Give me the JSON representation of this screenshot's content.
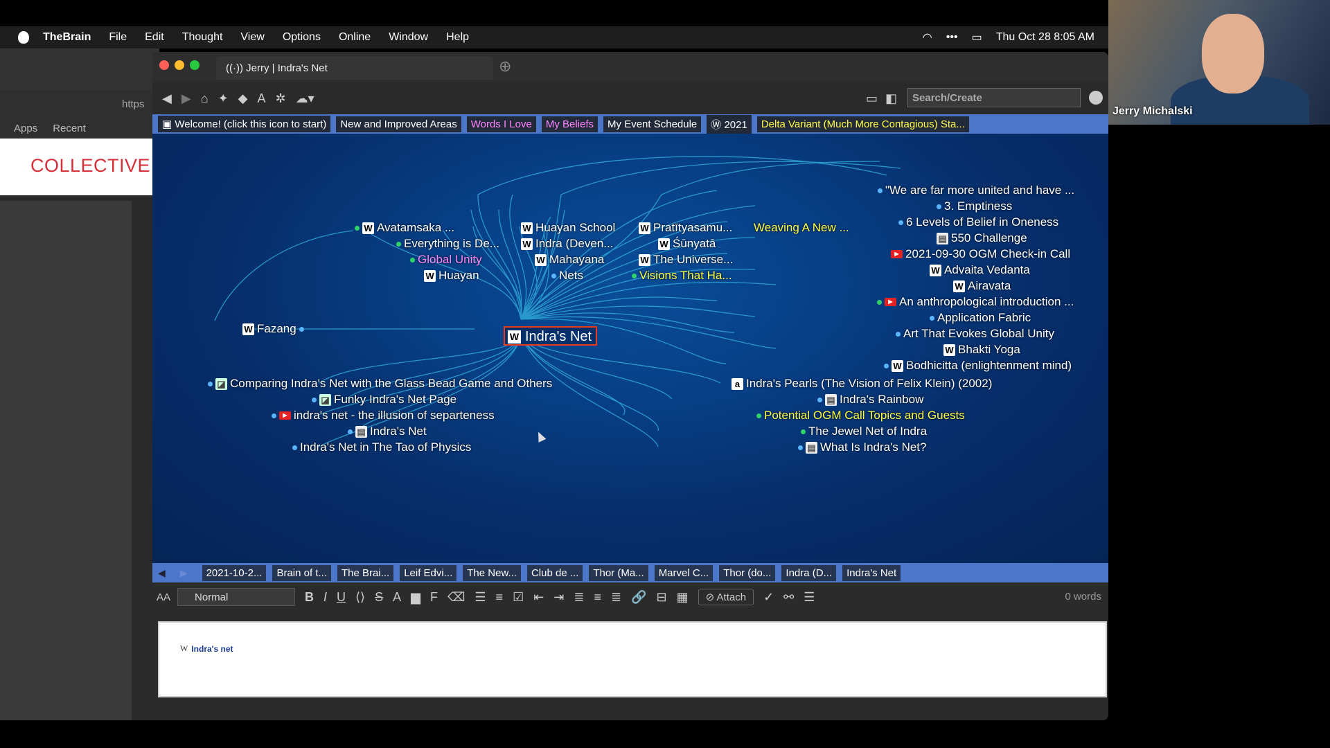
{
  "menubar": {
    "app": "TheBrain",
    "items": [
      "File",
      "Edit",
      "Thought",
      "View",
      "Options",
      "Online",
      "Window",
      "Help"
    ],
    "clock": "Thu Oct 28  8:05 AM"
  },
  "browser": {
    "address": "https",
    "bookmarks": [
      "Apps",
      "Recent"
    ],
    "site_title": "COLLECTIVE"
  },
  "window": {
    "tab_title": "Jerry | Indra's Net",
    "new_tab": "⊕",
    "search_placeholder": "Search/Create"
  },
  "pins": [
    {
      "label": "Welcome! (click this icon to start)",
      "style": "normal"
    },
    {
      "label": "New and Improved Areas",
      "style": "normal"
    },
    {
      "label": "Words I Love",
      "style": "pink"
    },
    {
      "label": "My Beliefs",
      "style": "pink"
    },
    {
      "label": "My Event Schedule",
      "style": "normal"
    },
    {
      "label": "2021",
      "style": "normal"
    },
    {
      "label": "Delta Variant (Much More Contagious) Sta...",
      "style": "yellow"
    }
  ],
  "plex": {
    "active": "Indra's Net",
    "parents": {
      "avatamsaka": "Avatamsaka ...",
      "huayan_school": "Huayan School",
      "pratityasamu": "Pratītyasamu...",
      "weaving": "Weaving A New ...",
      "everything": "Everything is De...",
      "indra_deven": "Indra (Deven...",
      "sunyata": "Śūnyatā",
      "global_unity": "Global Unity",
      "mahayana": "Mahayana",
      "universe": "The Universe...",
      "huayan": "Huayan",
      "nets": "Nets",
      "visions": "Visions That Ha..."
    },
    "jump": "Fazang",
    "siblings": [
      "\"We are far more united and have ...",
      "3. Emptiness",
      "6 Levels of Belief in Oneness",
      "550 Challenge",
      "2021-09-30 OGM Check-in Call",
      "Advaita Vedanta",
      "Airavata",
      "An anthropological introduction ...",
      "Application Fabric",
      "Art That Evokes Global Unity",
      "Bhakti Yoga",
      "Bodhicitta (enlightenment mind)"
    ],
    "children_left": [
      "Comparing Indra's Net with the Glass Bead Game and Others",
      "Funky Indra's Net Page",
      "indra's net - the illusion of separteness",
      "Indra's Net",
      "Indra's Net in The Tao of Physics"
    ],
    "children_right": [
      "Indra's Pearls (The Vision of Felix Klein) (2002)",
      "Indra's Rainbow",
      "Potential OGM Call Topics and Guests",
      "The Jewel Net of Indra",
      "What Is Indra's Net?"
    ]
  },
  "history": [
    "2021-10-2...",
    "Brain of t...",
    "The Brai...",
    "Leif Edvi...",
    "The New...",
    "Club de ...",
    "Thor (Ma...",
    "Marvel C...",
    "Thor (do...",
    "Indra (D...",
    "Indra's Net"
  ],
  "editor": {
    "style": "Normal",
    "attach": "Attach",
    "word_count": "0 words",
    "note_link": "Indra's net"
  },
  "webcam": {
    "name": "Jerry Michalski"
  },
  "colors": {
    "plex_bg": "#073f86",
    "pin_bar": "#4c76c9",
    "link_line": "#2fa8d8",
    "active_border": "#e83b1e"
  }
}
